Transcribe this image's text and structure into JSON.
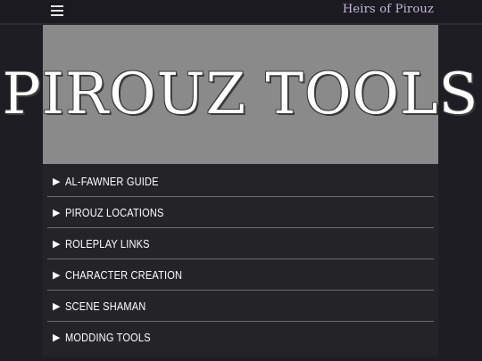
{
  "header": {
    "menu_icon": "hamburger-icon",
    "brand": "Heirs of Pirouz"
  },
  "hero": {
    "title": "PIROUZ TOOLS"
  },
  "menu": {
    "arrow_icon": "triangle-right-icon",
    "items": [
      {
        "label": "AL-FAWNER GUIDE"
      },
      {
        "label": "PIROUZ LOCATIONS"
      },
      {
        "label": "ROLEPLAY LINKS"
      },
      {
        "label": "CHARACTER CREATION"
      },
      {
        "label": "SCENE SHAMAN"
      },
      {
        "label": "MODDING TOOLS"
      }
    ]
  }
}
